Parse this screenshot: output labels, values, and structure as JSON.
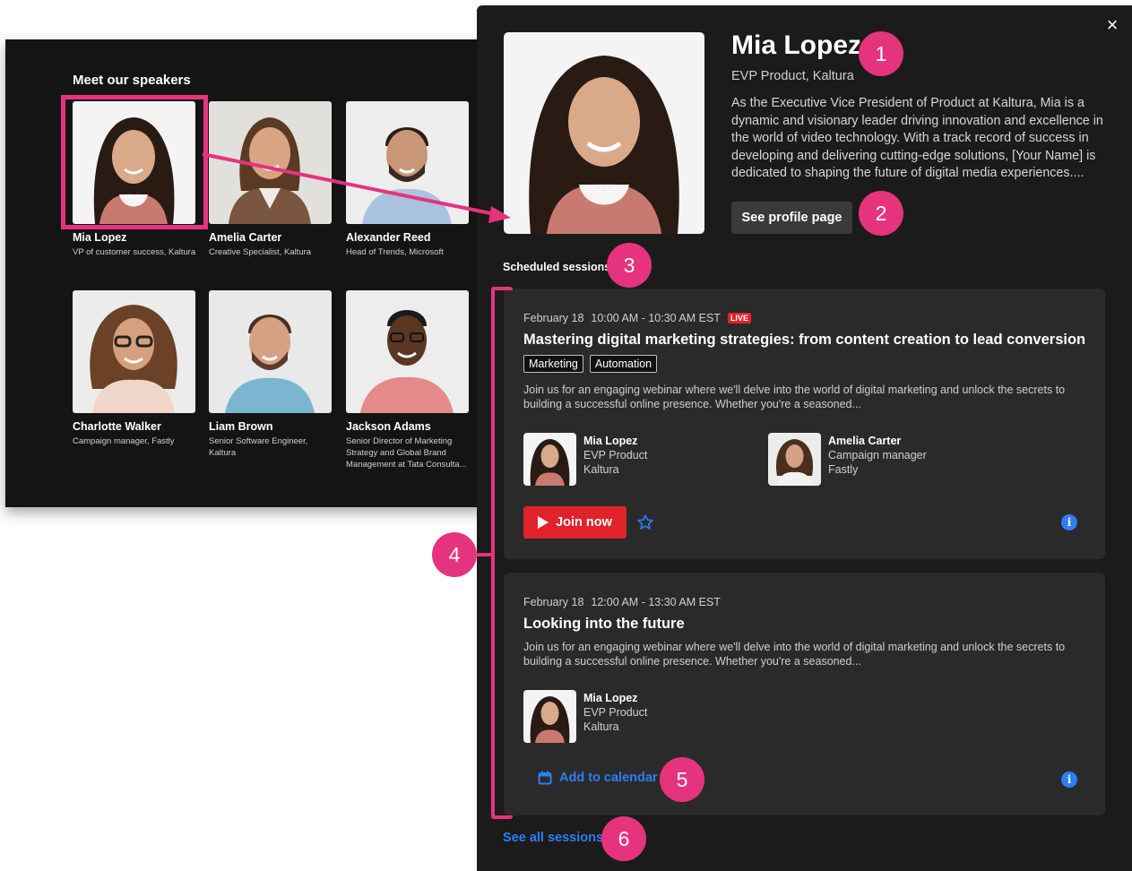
{
  "speakers_panel": {
    "title": "Meet our speakers",
    "speakers": [
      {
        "name": "Mia Lopez",
        "title": "VP of customer success, Kaltura"
      },
      {
        "name": "Amelia Carter",
        "title": "Creative Specialist, Kaltura"
      },
      {
        "name": "Alexander Reed",
        "title": "Head of Trends, Microsoft"
      },
      {
        "name": "Charlotte Walker",
        "title": "Campaign manager, Fastly"
      },
      {
        "name": "Liam Brown",
        "title": "Senior Software Engineer, Kaltura"
      },
      {
        "name": "Jackson Adams",
        "title": "Senior Director of Marketing Strategy and Global Brand Management at Tata Consulta..."
      }
    ]
  },
  "profile": {
    "name": "Mia Lopez",
    "role": "EVP Product, Kaltura",
    "bio": "As the Executive Vice President of Product at Kaltura, Mia is a dynamic and visionary leader driving innovation and excellence in the world of video technology. With a track record of success in developing and delivering cutting-edge solutions, [Your Name] is dedicated to shaping the future of digital media experiences....",
    "profile_button": "See profile page",
    "close_icon": "×"
  },
  "sessions": {
    "label": "Scheduled sessions",
    "items": [
      {
        "date": "February 18",
        "time": "10:00 AM - 10:30 AM EST",
        "live_badge": "LIVE",
        "title": "Mastering digital marketing strategies: from content creation to lead conversion",
        "tags": [
          "Marketing",
          "Automation"
        ],
        "description": "Join us for an engaging webinar where we'll delve into the world of digital marketing and unlock the secrets to building a successful online presence. Whether you're a seasoned...",
        "speakers": [
          {
            "name": "Mia Lopez",
            "role": "EVP Product",
            "company": "Kaltura"
          },
          {
            "name": "Amelia Carter",
            "role": "Campaign manager",
            "company": "Fastly"
          }
        ],
        "join_button": "Join now"
      },
      {
        "date": "February 18",
        "time": "12:00 AM - 13:30 AM EST",
        "title": "Looking into the future",
        "description": "Join us for an engaging webinar where we'll delve into the world of digital marketing and unlock the secrets to building a successful online presence. Whether you're a seasoned...",
        "speakers": [
          {
            "name": "Mia Lopez",
            "role": "EVP Product",
            "company": "Kaltura"
          }
        ],
        "calendar_button": "Add to calendar"
      }
    ],
    "see_all": "See all sessions"
  },
  "annotations": [
    "1",
    "2",
    "3",
    "4",
    "5",
    "6"
  ],
  "colors": {
    "accent_pink": "#e6337d",
    "live_red": "#e0232b",
    "link_blue": "#2d7df6",
    "panel_dark": "#1b1b1b",
    "card_dark": "#2a2a2a"
  }
}
